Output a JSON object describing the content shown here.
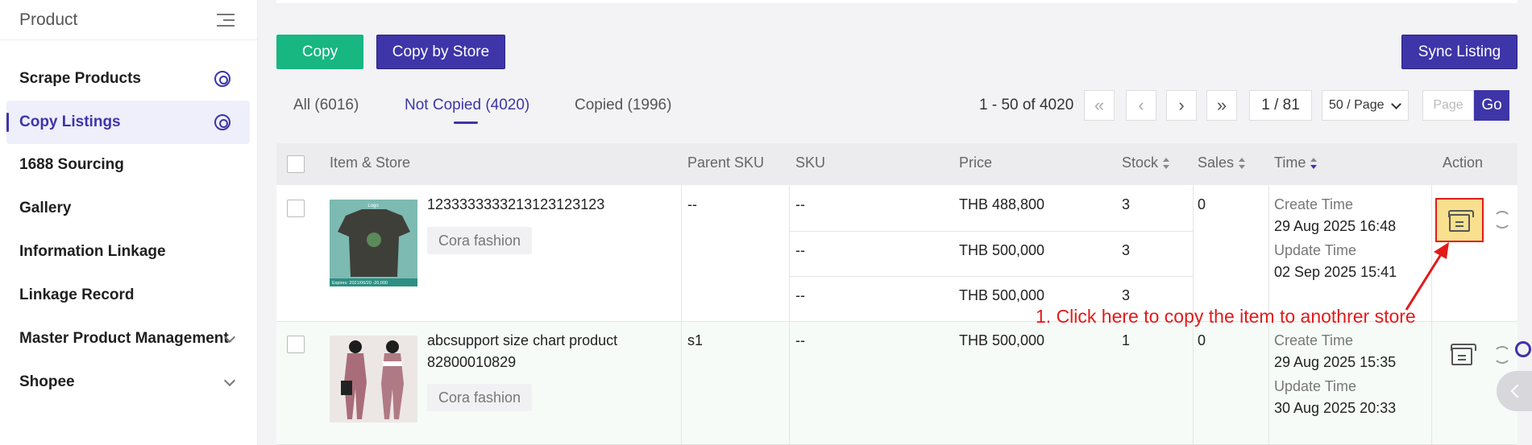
{
  "sidebar": {
    "title": "Product",
    "items": [
      {
        "label": "Scrape Products"
      },
      {
        "label": "Copy Listings"
      },
      {
        "label": "1688 Sourcing"
      },
      {
        "label": "Gallery"
      },
      {
        "label": "Information Linkage"
      },
      {
        "label": "Linkage Record"
      },
      {
        "label": "Master Product Management"
      },
      {
        "label": "Shopee"
      }
    ],
    "active_item": "Copy Listings"
  },
  "toolbar": {
    "copy_label": "Copy",
    "copy_by_store_label": "Copy by Store",
    "sync_listing_label": "Sync Listing"
  },
  "tabs": [
    {
      "label": "All (6016)"
    },
    {
      "label": "Not Copied (4020)"
    },
    {
      "label": "Copied (1996)"
    }
  ],
  "active_tab": "Not Copied (4020)",
  "pagination": {
    "range_text": "1 - 50 of 4020",
    "first_glyph": "«",
    "prev_glyph": "‹",
    "next_glyph": "›",
    "last_glyph": "»",
    "current_page": "1 / 81",
    "page_size": "50 / Page",
    "page_placeholder": "Page",
    "go_label": "Go"
  },
  "table": {
    "headers": {
      "item_store": "Item & Store",
      "parent_sku": "Parent SKU",
      "sku": "SKU",
      "price": "Price",
      "stock": "Stock",
      "sales": "Sales",
      "time": "Time",
      "action": "Action"
    },
    "rows": [
      {
        "title": "1233333332131231231 23",
        "title_full": "12333333332131231231 23",
        "store": "Cora fashion",
        "parent_sku": "--",
        "variants": [
          {
            "sku": "--",
            "price": "THB 488,800",
            "stock": "3"
          },
          {
            "sku": "--",
            "price": "THB 500,000",
            "stock": "3"
          },
          {
            "sku": "--",
            "price": "THB 500,000",
            "stock": "3"
          }
        ],
        "sales": "0",
        "create_label": "Create Time",
        "create_time": "29 Aug 2025 16:48",
        "update_label": "Update Time",
        "update_time": "02 Sep 2025 15:41"
      },
      {
        "title_line1": "abcsupport size chart product",
        "title_line2": "82800010829",
        "store": "Cora fashion",
        "parent_sku": "s1",
        "variants": [
          {
            "sku": "--",
            "price": "THB 500,000",
            "stock": "1"
          }
        ],
        "sales": "0",
        "create_label": "Create Time",
        "create_time": "29 Aug 2025 15:35",
        "update_label": "Update Time",
        "update_time": "30 Aug 2025 20:33"
      }
    ]
  },
  "row1_title_text": "1233333333213123123123",
  "thumb1_caption_top": "Logo",
  "thumb1_caption_bottom": "Expires: 2021/06/20  -20,000",
  "annotation": "1. Click here to copy the item to anothrer store",
  "colors": {
    "accent": "#3d35a8",
    "green": "#18b680",
    "annotation_red": "#e21a1a",
    "highlight_yellow": "#f8e08e"
  }
}
